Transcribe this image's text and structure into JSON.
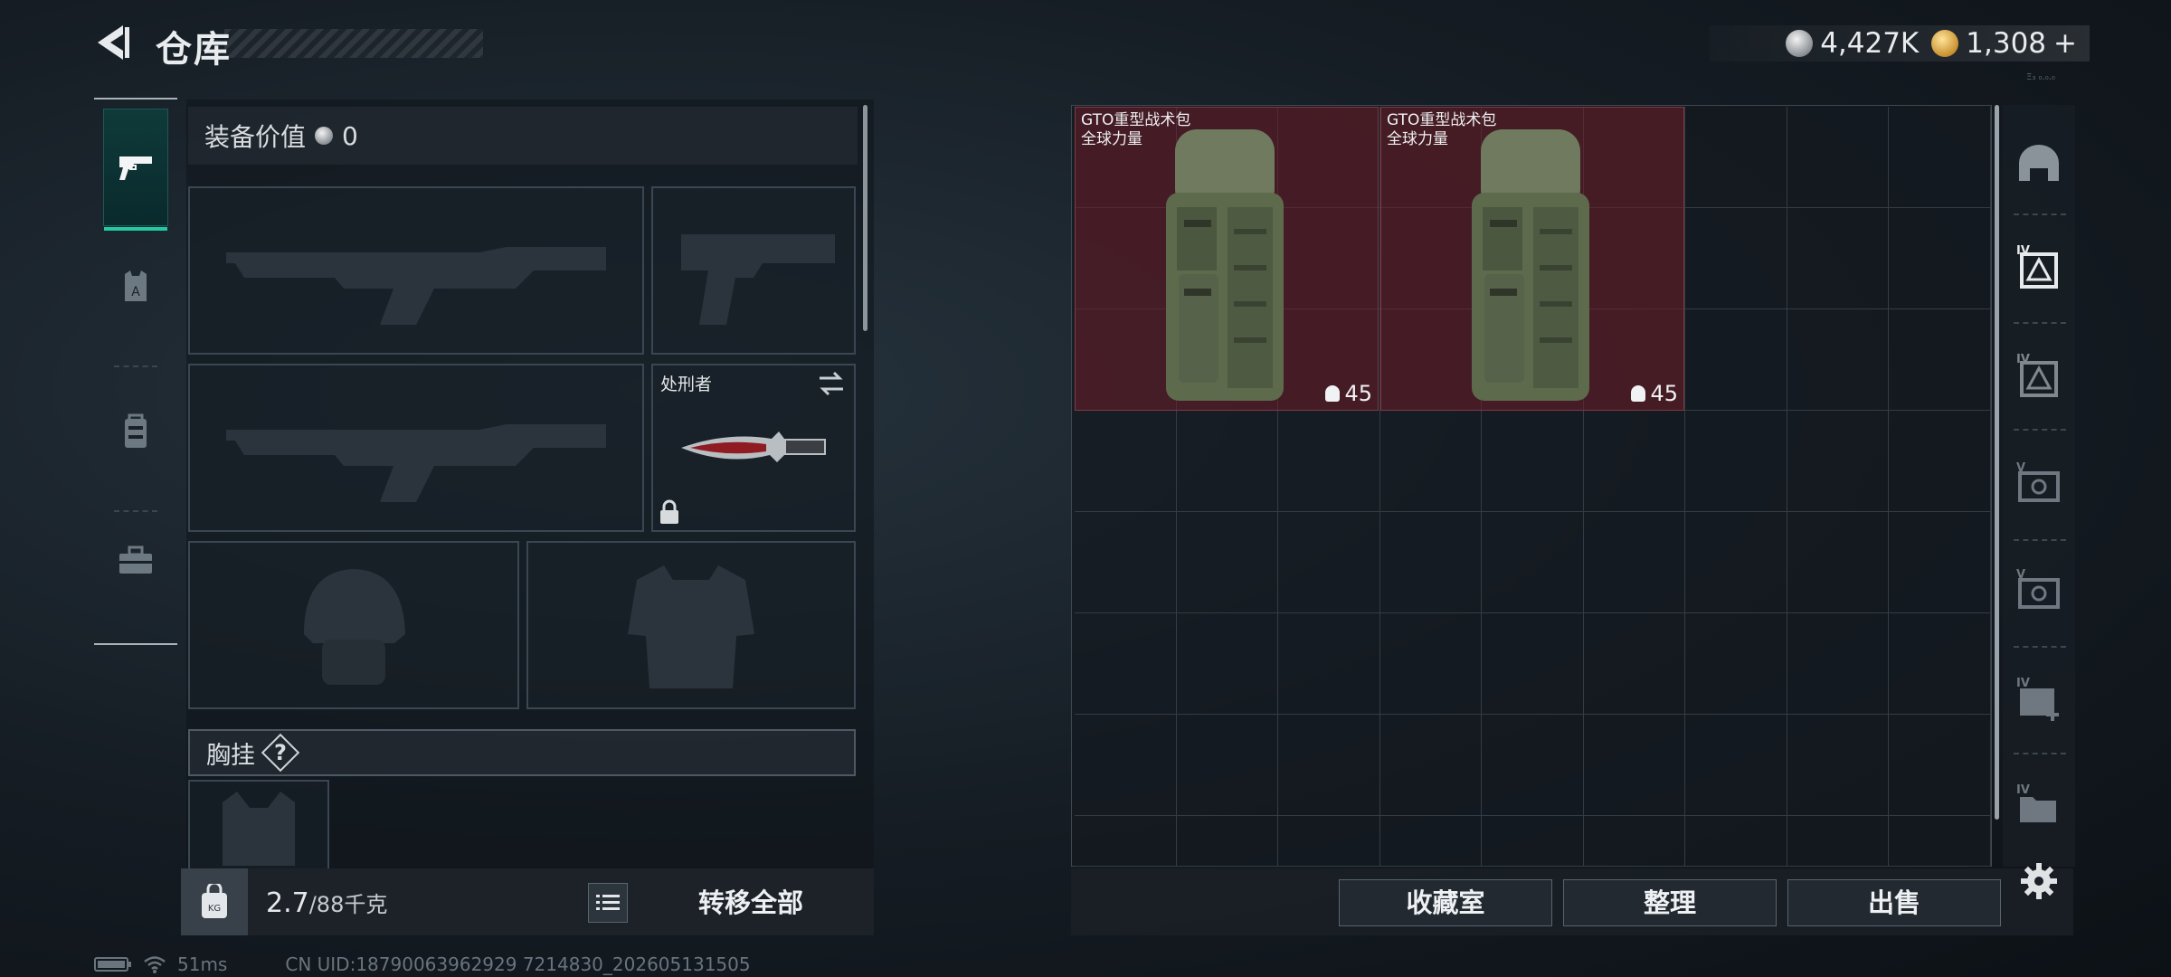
{
  "header": {
    "title": "仓库",
    "currency": {
      "silver": "4,427K",
      "gold": "1,308",
      "gold_add": "+"
    },
    "tiny_text": "Ξ₃ ₀.₀.₀"
  },
  "left_nav": {
    "items": [
      "pistol-icon",
      "armor-vest-icon",
      "backpack-icon",
      "toolbox-icon"
    ],
    "active": 0
  },
  "equipment": {
    "value_label": "装备价值",
    "value": "0",
    "knife_name": "处刑者",
    "chest_label": "胸挂",
    "chest_help": "?"
  },
  "capacity": {
    "current": "2.7",
    "max": "/88千克",
    "transfer_all": "转移全部"
  },
  "status_bar": {
    "ping": "51ms",
    "uid": "CN UID:18790063962929 7214830_202605131505"
  },
  "stash": {
    "items": [
      {
        "name": "GTO重型战术包",
        "sub": "全球力量",
        "durability": "45"
      },
      {
        "name": "GTO重型战术包",
        "sub": "全球力量",
        "durability": "45"
      }
    ],
    "buttons": {
      "collection": "收藏室",
      "sort": "整理",
      "sell": "出售"
    }
  },
  "right_nav": {
    "items": [
      "helmet-icon",
      "tier-iv-armor-icon",
      "tier-iv-chest-icon",
      "tier-v-bag-icon",
      "tier-v-case-icon",
      "tier-iv-add-icon",
      "tier-iv-folder-icon",
      "settings-gear-icon"
    ],
    "labels": [
      "",
      "IV",
      "IV",
      "V",
      "V",
      "IV",
      "IV"
    ]
  },
  "colors": {
    "accent": "#22c9a3",
    "item_bg": "#6e1e28"
  }
}
